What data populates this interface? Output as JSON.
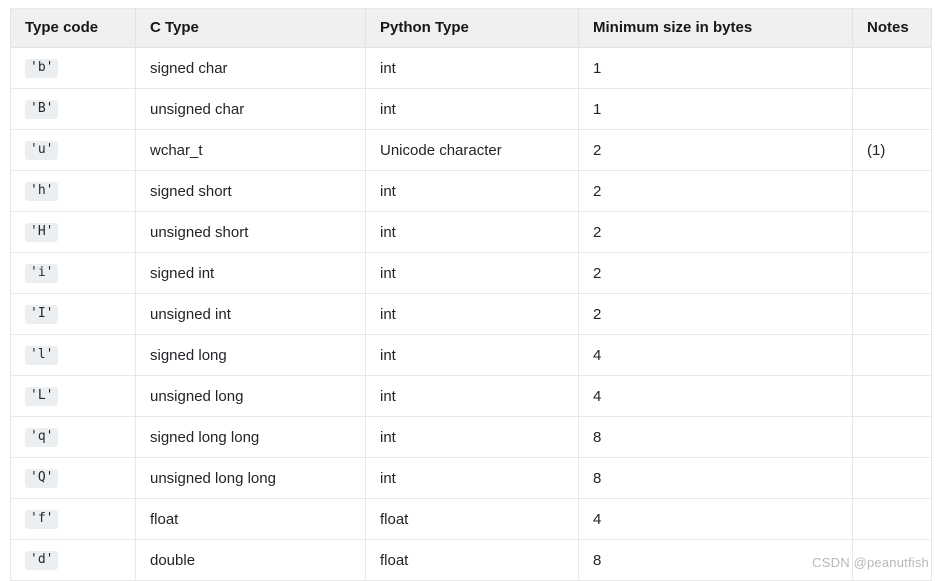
{
  "table": {
    "columns": [
      "Type code",
      "C Type",
      "Python Type",
      "Minimum size in bytes",
      "Notes"
    ],
    "rows": [
      {
        "code": "'b'",
        "c_type": "signed char",
        "python_type": "int",
        "min_size": "1",
        "notes": ""
      },
      {
        "code": "'B'",
        "c_type": "unsigned char",
        "python_type": "int",
        "min_size": "1",
        "notes": ""
      },
      {
        "code": "'u'",
        "c_type": "wchar_t",
        "python_type": "Unicode character",
        "min_size": "2",
        "notes": "(1)"
      },
      {
        "code": "'h'",
        "c_type": "signed short",
        "python_type": "int",
        "min_size": "2",
        "notes": ""
      },
      {
        "code": "'H'",
        "c_type": "unsigned short",
        "python_type": "int",
        "min_size": "2",
        "notes": ""
      },
      {
        "code": "'i'",
        "c_type": "signed int",
        "python_type": "int",
        "min_size": "2",
        "notes": ""
      },
      {
        "code": "'I'",
        "c_type": "unsigned int",
        "python_type": "int",
        "min_size": "2",
        "notes": ""
      },
      {
        "code": "'l'",
        "c_type": "signed long",
        "python_type": "int",
        "min_size": "4",
        "notes": ""
      },
      {
        "code": "'L'",
        "c_type": "unsigned long",
        "python_type": "int",
        "min_size": "4",
        "notes": ""
      },
      {
        "code": "'q'",
        "c_type": "signed long long",
        "python_type": "int",
        "min_size": "8",
        "notes": ""
      },
      {
        "code": "'Q'",
        "c_type": "unsigned long long",
        "python_type": "int",
        "min_size": "8",
        "notes": ""
      },
      {
        "code": "'f'",
        "c_type": "float",
        "python_type": "float",
        "min_size": "4",
        "notes": ""
      },
      {
        "code": "'d'",
        "c_type": "double",
        "python_type": "float",
        "min_size": "8",
        "notes": ""
      }
    ]
  },
  "watermark": {
    "text": "CSDN @peanutfish"
  },
  "colors": {
    "header_background": "#f0f0f0",
    "code_badge_background": "#eceff1",
    "border": "#e8e8e8",
    "text": "#23242a",
    "watermark_text": "#b9b9b9"
  }
}
